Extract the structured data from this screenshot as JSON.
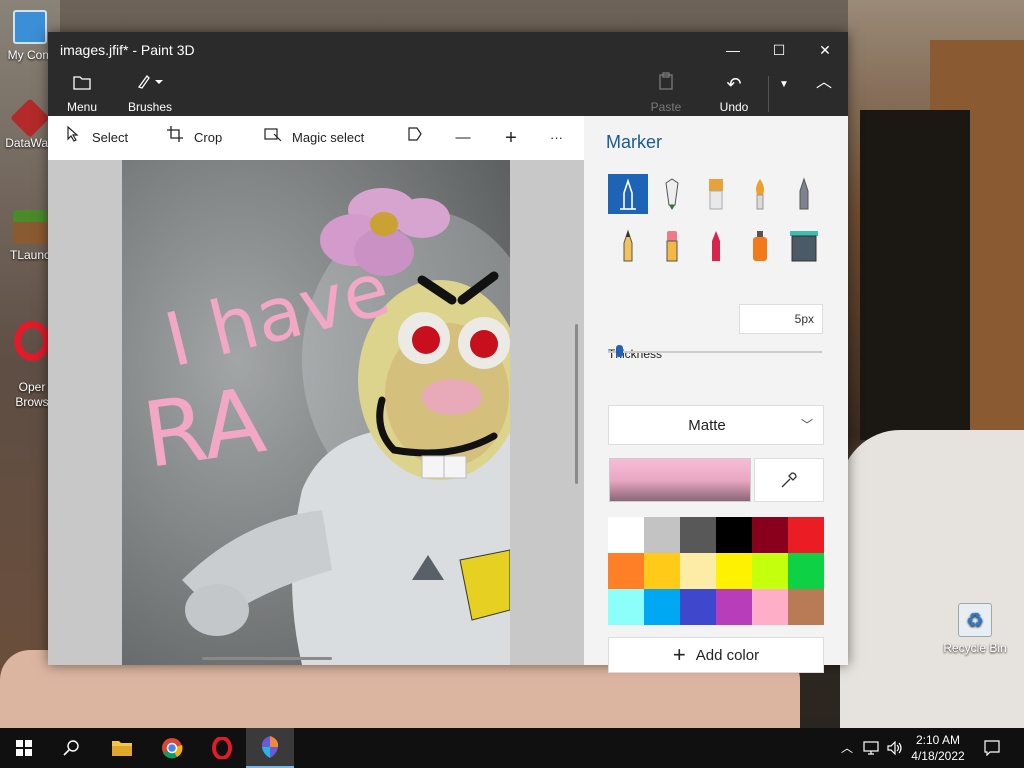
{
  "window": {
    "title": "images.jfif* - Paint 3D",
    "minimize_icon": "minimize-icon",
    "maximize_icon": "maximize-icon",
    "close_icon": "close-icon"
  },
  "ribbon": {
    "menu_label": "Menu",
    "brushes_label": "Brushes",
    "paste_label": "Paste",
    "undo_label": "Undo"
  },
  "toolbar": {
    "select_label": "Select",
    "crop_label": "Crop",
    "magic_select_label": "Magic select",
    "more_label": "···"
  },
  "artwork": {
    "handwriting_line1": "I have",
    "handwriting_line2": "RA"
  },
  "panel": {
    "title": "Marker",
    "thickness_label": "Thickness",
    "thickness_value": "5px",
    "thickness_level": 0.05,
    "finish_value": "Matte",
    "current_color": "#f5b8d2",
    "add_color_label": "Add color",
    "brushes": [
      {
        "name": "marker-icon",
        "selected": true
      },
      {
        "name": "calligraphy-pen-icon",
        "selected": false
      },
      {
        "name": "oil-brush-icon",
        "selected": false
      },
      {
        "name": "watercolor-icon",
        "selected": false
      },
      {
        "name": "pixel-pen-icon",
        "selected": false
      },
      {
        "name": "pencil-icon",
        "selected": false
      },
      {
        "name": "eraser-icon",
        "selected": false
      },
      {
        "name": "crayon-icon",
        "selected": false
      },
      {
        "name": "spray-can-icon",
        "selected": false
      },
      {
        "name": "fill-bucket-icon",
        "selected": false
      }
    ],
    "palette": [
      "#ffffff",
      "#c3c3c3",
      "#585858",
      "#000000",
      "#88001b",
      "#ec1c24",
      "#ff7f27",
      "#ffca18",
      "#fdeca6",
      "#fff200",
      "#c4ff0e",
      "#0ed145",
      "#8cfffb",
      "#00a8f3",
      "#3f48cc",
      "#b83dba",
      "#ffaec8",
      "#b97a56"
    ]
  },
  "desktop": {
    "icons": [
      {
        "label": "My Com"
      },
      {
        "label": "DataWag"
      },
      {
        "label": "TLaunc"
      },
      {
        "label": "Oper\nBrows"
      },
      {
        "label": "Recycle Bin"
      }
    ]
  },
  "taskbar": {
    "time": "2:10 AM",
    "date": "4/18/2022",
    "apps": [
      "start-icon",
      "search-icon",
      "file-explorer-icon",
      "chrome-icon",
      "opera-icon",
      "paint-3d-icon"
    ]
  }
}
